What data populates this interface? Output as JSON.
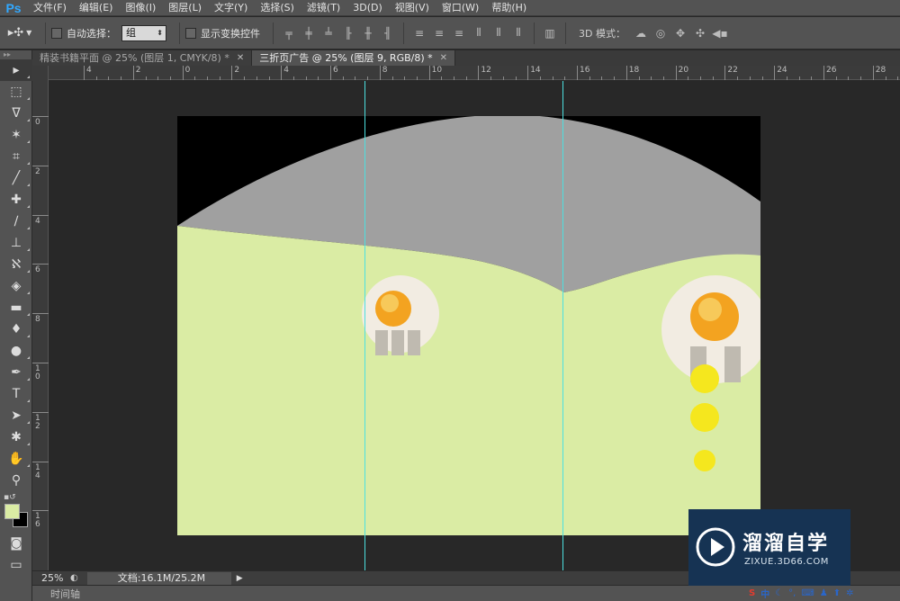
{
  "app": {
    "logo": "Ps"
  },
  "menu": [
    "文件(F)",
    "编辑(E)",
    "图像(I)",
    "图层(L)",
    "文字(Y)",
    "选择(S)",
    "滤镜(T)",
    "3D(D)",
    "视图(V)",
    "窗口(W)",
    "帮助(H)"
  ],
  "options": {
    "auto_select_label": "自动选择：",
    "auto_select_value": "组",
    "show_transform_label": "显示变换控件",
    "mode_3d_label": "3D 模式："
  },
  "tabs": [
    {
      "label": "精装书籍平面 @ 25% (图层 1, CMYK/8) *",
      "active": false
    },
    {
      "label": "三折页广告 @ 25% (图层 9, RGB/8) *",
      "active": true
    }
  ],
  "ruler_h_labels": [
    "4",
    "2",
    "0",
    "2",
    "4",
    "6",
    "8",
    "10",
    "12",
    "14",
    "16",
    "18",
    "20",
    "22",
    "24",
    "26",
    "28"
  ],
  "ruler_v_labels": [
    "0",
    "2",
    "4",
    "6",
    "8",
    "10",
    "12",
    "14",
    "16"
  ],
  "status": {
    "zoom": "25%",
    "doc_info": "文档:16.1M/25.2M"
  },
  "timeline_label": "时间轴",
  "watermark": {
    "title": "溜溜自学",
    "url": "ZIXUE.3D66.COM"
  },
  "tray_ime": "中",
  "colors": {
    "foreground": "#daeca4",
    "background": "#000000",
    "guide": "#4ce0e0",
    "accent": "#31a8ff"
  }
}
